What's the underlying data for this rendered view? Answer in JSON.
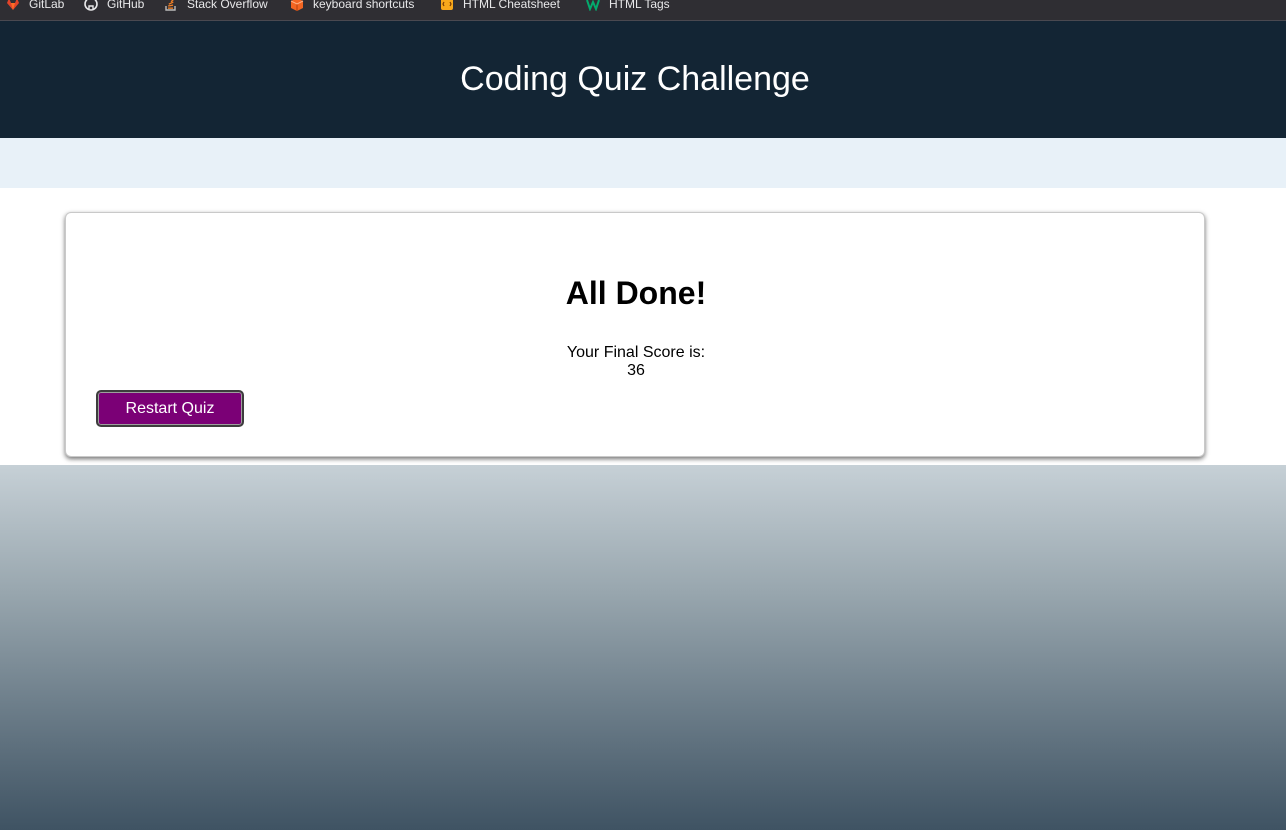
{
  "bookmarks": [
    {
      "label": "GitLab",
      "icon": "gitlab-icon"
    },
    {
      "label": "GitHub",
      "icon": "github-icon"
    },
    {
      "label": "Stack Overflow",
      "icon": "stackoverflow-icon"
    },
    {
      "label": "keyboard shortcuts",
      "icon": "keyboard-shortcuts-icon"
    },
    {
      "label": "HTML Cheatsheet",
      "icon": "html-cheatsheet-icon"
    },
    {
      "label": "HTML Tags",
      "icon": "html-tags-icon"
    }
  ],
  "header": {
    "title": "Coding Quiz Challenge"
  },
  "result": {
    "title": "All Done!",
    "score_label": "Your Final Score is:",
    "score_value": "36",
    "restart_label": "Restart Quiz"
  },
  "colors": {
    "header_bg": "#132534",
    "strip_bg": "#e8f1f8",
    "button_bg": "#7b0076",
    "gradient_top": "#c6d0d6",
    "gradient_bottom": "#3f5363"
  }
}
